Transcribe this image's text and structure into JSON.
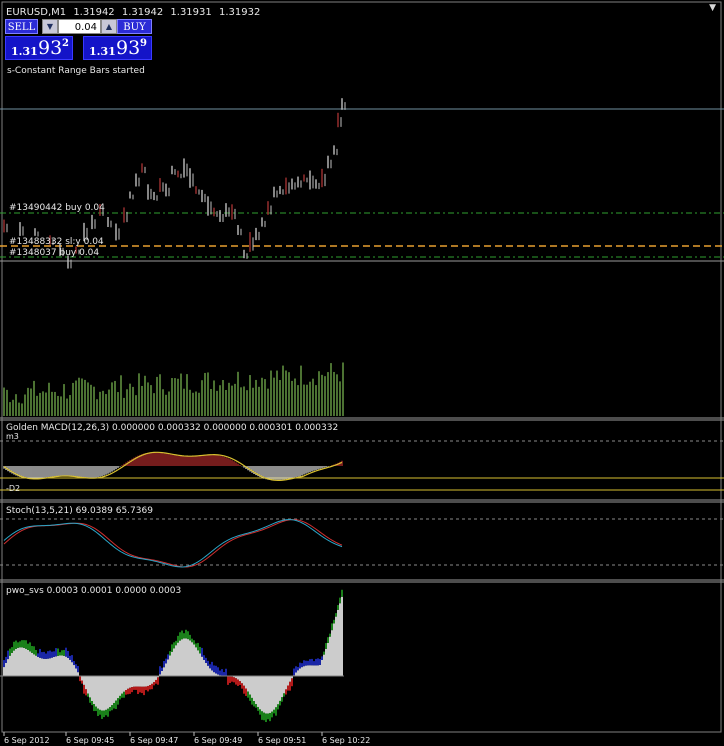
{
  "chart_header": {
    "symbol": "EURUSD,M1",
    "prices": [
      "1.31942",
      "1.31942",
      "1.31931",
      "1.31932"
    ]
  },
  "one_click_panel": {
    "sell_label": "SELL",
    "buy_label": "BUY",
    "lot_value": "0.04",
    "sell_price": {
      "prefix": "1.31",
      "big": "93",
      "sup": "2"
    },
    "buy_price": {
      "prefix": "1.31",
      "big": "93",
      "sup": "9"
    }
  },
  "status_message": "s-Constant Range Bars started",
  "order_labels": [
    "#13490442 buy 0.04",
    "#13488332 sl:y 0.04",
    "#1348037 buy 0.04"
  ],
  "indicators": {
    "macd": {
      "label": "Golden MACD(12,26,3) 0.000000 0.000332 0.000000 0.000301 0.000332",
      "level_top": "m3",
      "level_bottom": "-D2"
    },
    "stoch": {
      "label": "Stoch(13,5,21) 69.0389 65.7369"
    },
    "pwo": {
      "label": "pwo_svs 0.0003 0.0001 0.0000 0.0003"
    }
  },
  "time_axis": {
    "ticks": [
      "6 Sep 2012",
      "6 Sep 09:45",
      "6 Sep 09:47",
      "6 Sep 09:49",
      "6 Sep 09:51",
      "6 Sep 10:22"
    ]
  },
  "colors": {
    "background": "#000000",
    "candle": "#c0c0c0",
    "volume": "#5f8f3f",
    "order_green": "#2f9f2f",
    "order_orange": "#e8a030",
    "macd_pos": "#c03030",
    "stoch_main": "#2aa6c8",
    "stoch_signal": "#d03030",
    "pwo_green": "#20a020",
    "pwo_blue": "#2030d0",
    "pwo_red": "#e02020"
  },
  "icons": {
    "lot_down": "triangle-down-icon",
    "lot_up": "triangle-up-icon",
    "chart_corner": "triangle-down-icon"
  }
}
